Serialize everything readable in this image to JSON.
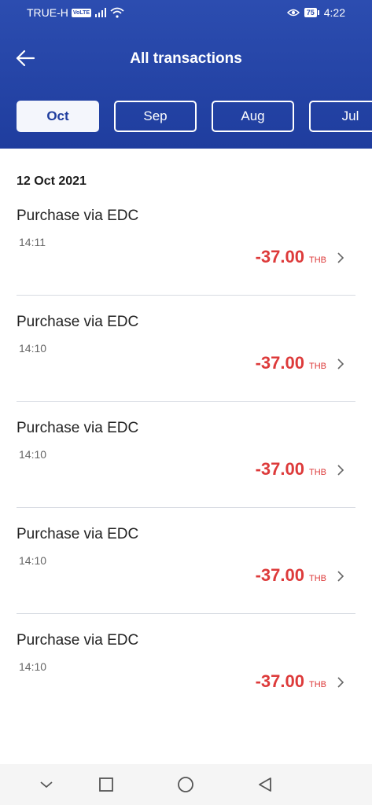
{
  "status_bar": {
    "carrier": "TRUE-H",
    "volte_badge": "VoLTE",
    "battery": "75",
    "time": "4:22"
  },
  "header": {
    "title": "All transactions"
  },
  "months": [
    {
      "label": "Oct",
      "active": true
    },
    {
      "label": "Sep",
      "active": false
    },
    {
      "label": "Aug",
      "active": false
    },
    {
      "label": "Jul",
      "active": false
    }
  ],
  "date_group": "12 Oct 2021",
  "transactions": [
    {
      "title": "Purchase via EDC",
      "time": "14:11",
      "amount": "-37.00",
      "currency": "THB"
    },
    {
      "title": "Purchase via EDC",
      "time": "14:10",
      "amount": "-37.00",
      "currency": "THB"
    },
    {
      "title": "Purchase via EDC",
      "time": "14:10",
      "amount": "-37.00",
      "currency": "THB"
    },
    {
      "title": "Purchase via EDC",
      "time": "14:10",
      "amount": "-37.00",
      "currency": "THB"
    },
    {
      "title": "Purchase via EDC",
      "time": "14:10",
      "amount": "-37.00",
      "currency": "THB"
    }
  ],
  "icons": {
    "back": "arrow-left-icon",
    "chevron": "chevron-right-icon",
    "nav": [
      "chevron-down-icon",
      "square-icon",
      "circle-icon",
      "triangle-back-icon"
    ]
  },
  "colors": {
    "header": "#1f3d9e",
    "amount": "#dd3a3a",
    "divider": "#d7dbe2"
  }
}
